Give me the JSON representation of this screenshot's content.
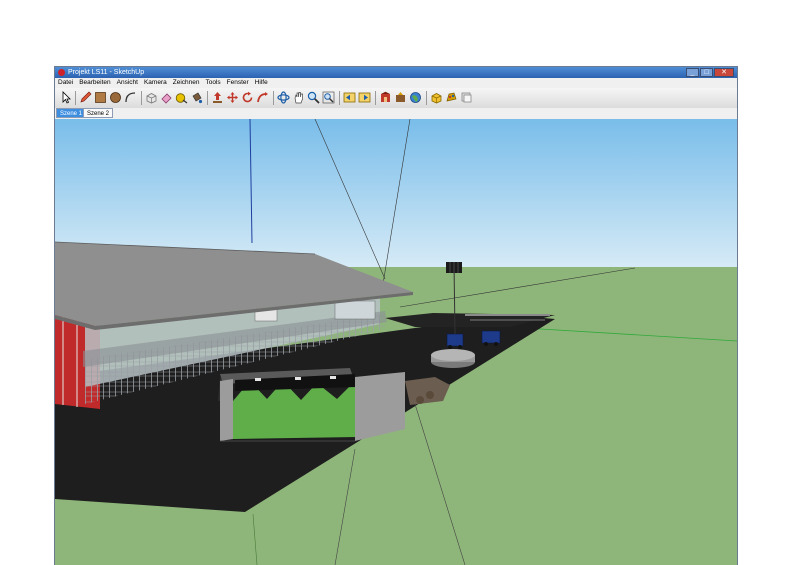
{
  "window": {
    "title": "Projekt LS11 - SketchUp"
  },
  "window_controls": {
    "minimize": "_",
    "maximize": "□",
    "close": "✕"
  },
  "menubar": {
    "items": [
      "Datei",
      "Bearbeiten",
      "Ansicht",
      "Kamera",
      "Zeichnen",
      "Tools",
      "Fenster",
      "Hilfe"
    ]
  },
  "toolbar": {
    "tools": [
      {
        "name": "select-icon",
        "color": "#000000"
      },
      {
        "name": "pencil-icon",
        "color": "#c0392b"
      },
      {
        "name": "rectangle-icon",
        "color": "#8a5a2b"
      },
      {
        "name": "circle-icon",
        "color": "#7a4a1e"
      },
      {
        "name": "arc-icon",
        "color": "#333333"
      },
      {
        "name": "make-component-icon",
        "color": "#8c8c8c"
      },
      {
        "name": "eraser-icon",
        "color": "#d47aa7"
      },
      {
        "name": "tape-measure-icon",
        "color": "#d4b000"
      },
      {
        "name": "paint-bucket-icon",
        "color": "#6b4a2b"
      },
      {
        "name": "push-pull-icon",
        "color": "#c0392b"
      },
      {
        "name": "move-icon",
        "color": "#c0392b"
      },
      {
        "name": "rotate-icon",
        "color": "#c0392b"
      },
      {
        "name": "follow-me-icon",
        "color": "#c0392b"
      },
      {
        "name": "orbit-icon",
        "color": "#1f5fa8"
      },
      {
        "name": "pan-icon",
        "color": "#555555"
      },
      {
        "name": "zoom-icon",
        "color": "#1f5fa8"
      },
      {
        "name": "zoom-extents-icon",
        "color": "#1f5fa8"
      },
      {
        "name": "previous-view-icon",
        "color": "#d4a000"
      },
      {
        "name": "next-view-icon",
        "color": "#d4a000"
      },
      {
        "name": "get-models-icon",
        "color": "#c0392b"
      },
      {
        "name": "share-model-icon",
        "color": "#6b4a2b"
      },
      {
        "name": "google-earth-icon",
        "color": "#1f5fa8"
      },
      {
        "name": "components-icon",
        "color": "#d4a000"
      },
      {
        "name": "materials-icon",
        "color": "#c0392b"
      },
      {
        "name": "styles-icon",
        "color": "#aaaaaa"
      }
    ]
  },
  "scenes": {
    "tabs": [
      "Szene 1",
      "Szene 2"
    ],
    "active": "Szene 1"
  },
  "colors": {
    "sky_top": "#79bdea",
    "sky_bottom": "#d7ebf6",
    "ground": "#8fb67a",
    "tarmac": "#1e1e1e",
    "roof": "#8f8f8f",
    "barn_wall": "#c12a2a",
    "hedge": "#5fae4a"
  }
}
